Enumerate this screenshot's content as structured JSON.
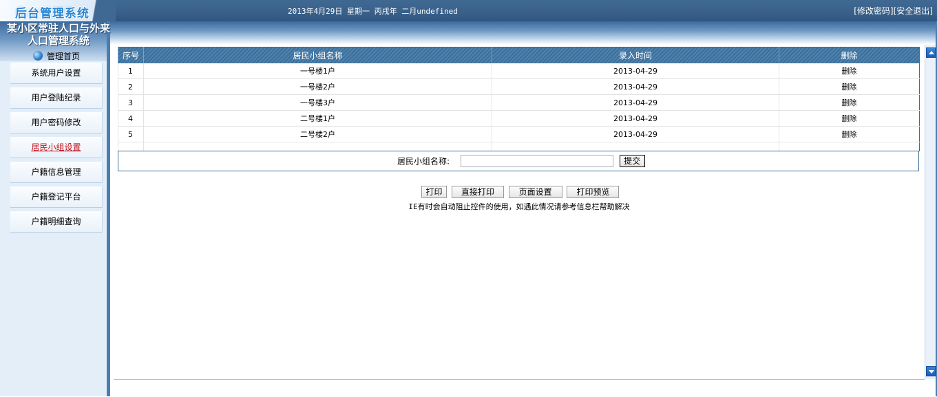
{
  "header": {
    "logo": "后台管理系统",
    "date": "2013年4月29日 星期一 丙戌年 二月undefined",
    "change_password": "[修改密码]",
    "logout": "[安全退出]"
  },
  "sidebar": {
    "system_title_line1": "某小区常驻人口与外来",
    "system_title_line2": "人口管理系统",
    "home": "管理首页",
    "items": [
      {
        "label": "系统用户设置"
      },
      {
        "label": "用户登陆纪录"
      },
      {
        "label": "用户密码修改"
      },
      {
        "label": "居民小组设置"
      },
      {
        "label": "户籍信息管理"
      },
      {
        "label": "户籍登记平台"
      },
      {
        "label": "户籍明细查询"
      }
    ]
  },
  "table": {
    "columns": [
      "序号",
      "居民小组名称",
      "录入时间",
      "删除"
    ],
    "rows": [
      {
        "no": "1",
        "name": "一号楼1户",
        "time": "2013-04-29",
        "action": "删除"
      },
      {
        "no": "2",
        "name": "一号楼2户",
        "time": "2013-04-29",
        "action": "删除"
      },
      {
        "no": "3",
        "name": "一号楼3户",
        "time": "2013-04-29",
        "action": "删除"
      },
      {
        "no": "4",
        "name": "二号楼1户",
        "time": "2013-04-29",
        "action": "删除"
      },
      {
        "no": "5",
        "name": "二号楼2户",
        "time": "2013-04-29",
        "action": "删除"
      }
    ]
  },
  "form": {
    "label": "居民小组名称:",
    "value": "",
    "submit": "提交"
  },
  "print": {
    "print": "打印",
    "direct_print": "直接打印",
    "page_setup": "页面设置",
    "preview": "打印预览",
    "note": "IE有时会自动阻止控件的使用，如遇此情况请参考信息栏帮助解决"
  }
}
